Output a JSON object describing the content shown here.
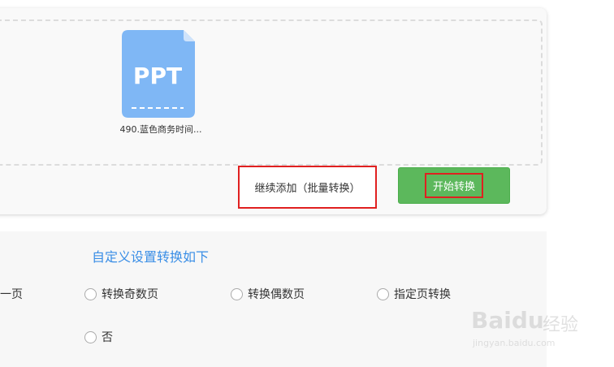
{
  "file": {
    "type_label": "PPT",
    "name": "490.蓝色商务时间..."
  },
  "buttons": {
    "add_more": "继续添加（批量转换）",
    "start": "开始转换"
  },
  "settings": {
    "title": "自定义设置转换如下",
    "partial_left": "一页",
    "options": [
      "转换奇数页",
      "转换偶数页",
      "指定页转换",
      "否"
    ]
  },
  "watermark": {
    "logo": "Baidu",
    "text": "经验",
    "url": "jingyan.baidu.com"
  },
  "colors": {
    "accent": "#3a8ee6",
    "start_button": "#5cb85c",
    "highlight": "#e02020",
    "file_icon": "#7fb7f5"
  }
}
